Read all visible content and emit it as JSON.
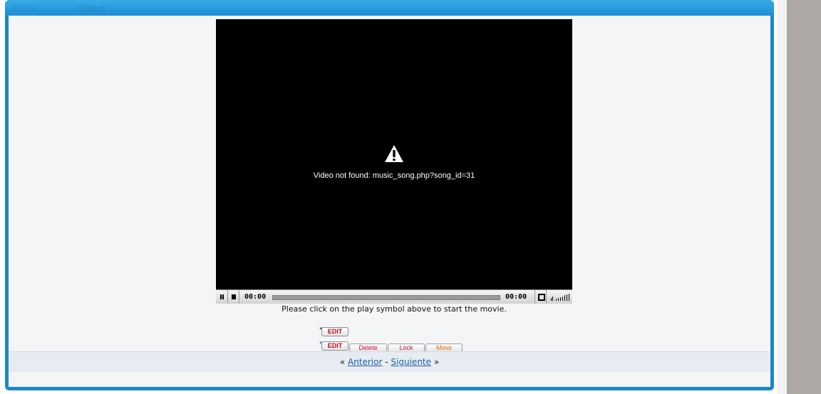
{
  "breadcrumb": {
    "item1": "Inicio",
    "item2": "Vídeos"
  },
  "player": {
    "error_text": "Video not found: music_song.php?song_id=31",
    "time_elapsed": "00:00",
    "time_total": "00:00",
    "progress": 0,
    "caption": "Please click on the play symbol above to start the movie."
  },
  "admin": {
    "star": "*",
    "edit_label": "EDIT",
    "delete_label": "Delete",
    "lock_label": "Lock",
    "move_label": "Move"
  },
  "pager": {
    "prev_quote": "«",
    "prev_label": "Anterior",
    "separator": "-",
    "next_label": "Siguiente",
    "next_quote": "»"
  },
  "icons": [
    "warning-icon",
    "pause-icon",
    "stop-icon",
    "fullscreen-icon",
    "volume-icon"
  ],
  "colors": {
    "frame": "#1c87c9",
    "link": "#1f5fa9",
    "edit_red": "#b3111d",
    "move_orange": "#e06a10"
  }
}
